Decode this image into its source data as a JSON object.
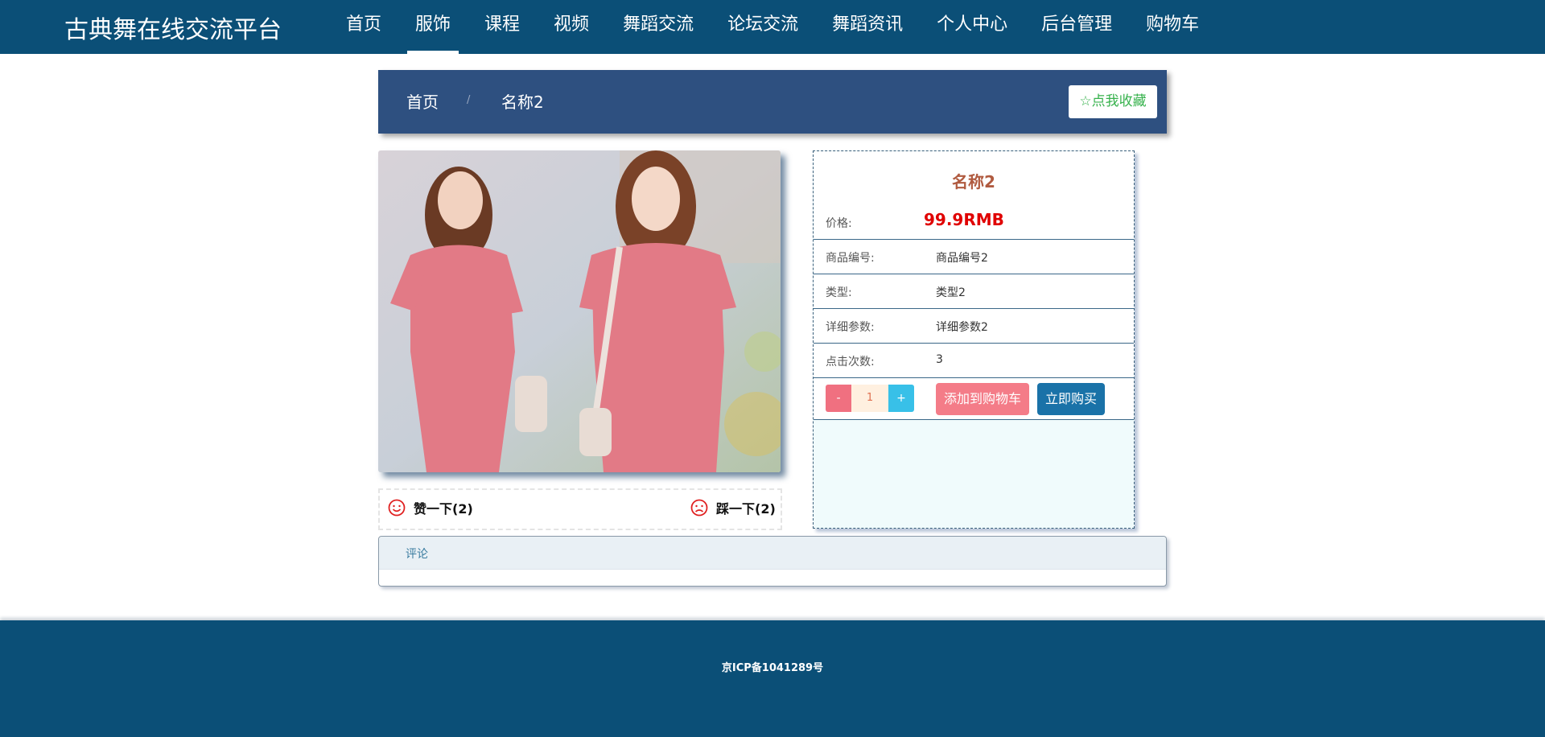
{
  "site": {
    "title": "古典舞在线交流平台"
  },
  "nav": {
    "items": [
      "首页",
      "服饰",
      "课程",
      "视频",
      "舞蹈交流",
      "论坛交流",
      "舞蹈资讯",
      "个人中心",
      "后台管理",
      "购物车"
    ],
    "active": "服饰"
  },
  "breadcrumb": {
    "home": "首页",
    "separator": "/",
    "current": "名称2"
  },
  "favorite": {
    "label": "☆点我收藏"
  },
  "votes": {
    "like_label": "赞一下(2)",
    "dislike_label": "踩一下(2)"
  },
  "product": {
    "name": "名称2",
    "price_label": "价格:",
    "price": "99.9RMB",
    "fields": [
      {
        "label": "商品编号:",
        "value": "商品编号2"
      },
      {
        "label": "类型:",
        "value": "类型2"
      },
      {
        "label": "详细参数:",
        "value": "详细参数2"
      },
      {
        "label": "点击次数:",
        "value": "3"
      }
    ]
  },
  "quantity": {
    "minus": "-",
    "value": "1",
    "plus": "+"
  },
  "actions": {
    "add_to_cart": "添加到购物车",
    "buy_now": "立即购买"
  },
  "comments": {
    "tab_label": "评论"
  },
  "footer": {
    "icp": "京ICP备1041289号"
  },
  "colors": {
    "header_bg": "#0b4f77",
    "crumb_bg": "#2e5080",
    "price": "#e00000",
    "cart_btn": "#f47c88",
    "buy_btn": "#1a72a8"
  }
}
